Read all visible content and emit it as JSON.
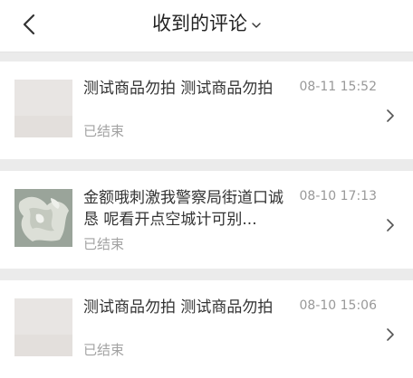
{
  "header": {
    "title": "收到的评论",
    "back_icon": "chevron-left-icon",
    "dropdown_icon": "chevron-down-icon"
  },
  "comments": [
    {
      "text": "测试商品勿拍 测试商品勿拍",
      "time": "08-11 15:52",
      "status": "已结束"
    },
    {
      "text": "金额哦刺激我警察局街道口诚恳 呢看开点空城计可别...",
      "time": "08-10 17:13",
      "status": "已结束"
    },
    {
      "text": "测试商品勿拍 测试商品勿拍",
      "time": "08-10 15:06",
      "status": "已结束"
    }
  ],
  "colors": {
    "divider": "#ebebeb",
    "muted_text": "#999999",
    "body_text": "#333333"
  }
}
